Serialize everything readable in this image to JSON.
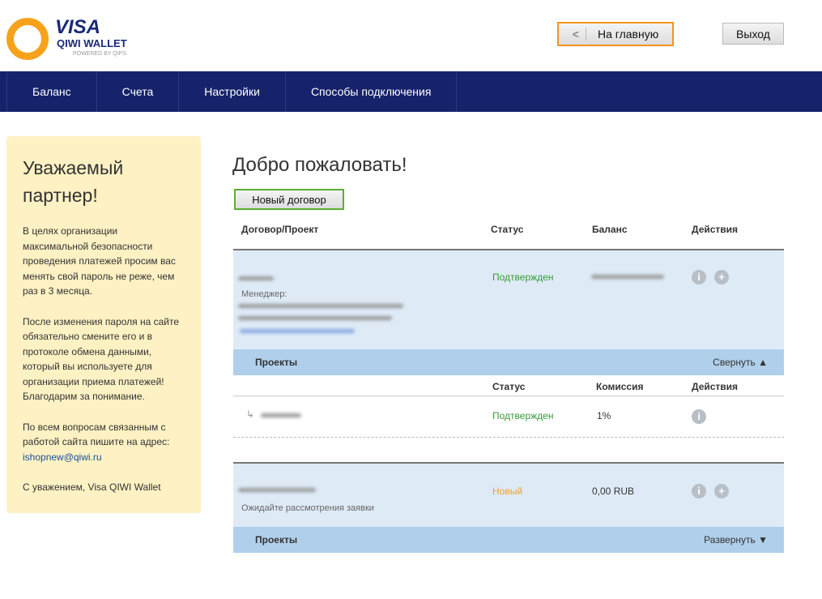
{
  "logo": {
    "brand": "VISA",
    "product": "QIWI WALLET",
    "tagline": "POWERED BY QIPS"
  },
  "header": {
    "home_button": "На главную",
    "home_arrow": "<",
    "exit_button": "Выход"
  },
  "nav": [
    "Баланс",
    "Счета",
    "Настройки",
    "Способы подключения"
  ],
  "sidebar": {
    "title": "Уважаемый партнер!",
    "p1": "В целях организации максимальной безопасности проведения платежей просим вас менять свой пароль не реже, чем раз в 3 месяца.",
    "p2": "После изменения пароля на сайте обязательно смените его и в протоколе обмена данными, который вы используете для организации приема платежей! Благодарим за понимание.",
    "p3": "По всем вопросам связанным с работой сайта пишите на адрес:",
    "email": "ishopnew@qiwi.ru",
    "p4": "С уважением, Visa QIWI Wallet"
  },
  "main": {
    "title": "Добро пожаловать!",
    "new_contract": "Новый договор",
    "columns": {
      "contract": "Договор/Проект",
      "status": "Статус",
      "balance": "Баланс",
      "actions": "Действия",
      "commission": "Комиссия"
    },
    "contracts": [
      {
        "status": "Подтвержден",
        "manager_label": "Менеджер:",
        "projects_label": "Проекты",
        "toggle": "Свернуть ▲",
        "projects": [
          {
            "status": "Подтвержден",
            "commission": "1%"
          }
        ]
      },
      {
        "status": "Новый",
        "balance": "0,00 RUB",
        "note": "Ожидайте рассмотрения заявки",
        "projects_label": "Проекты",
        "toggle": "Развернуть ▼"
      }
    ]
  },
  "colors": {
    "nav": "#16236b",
    "accent": "#f7941d",
    "green": "#3a9a3a",
    "new": "#f0a030"
  }
}
